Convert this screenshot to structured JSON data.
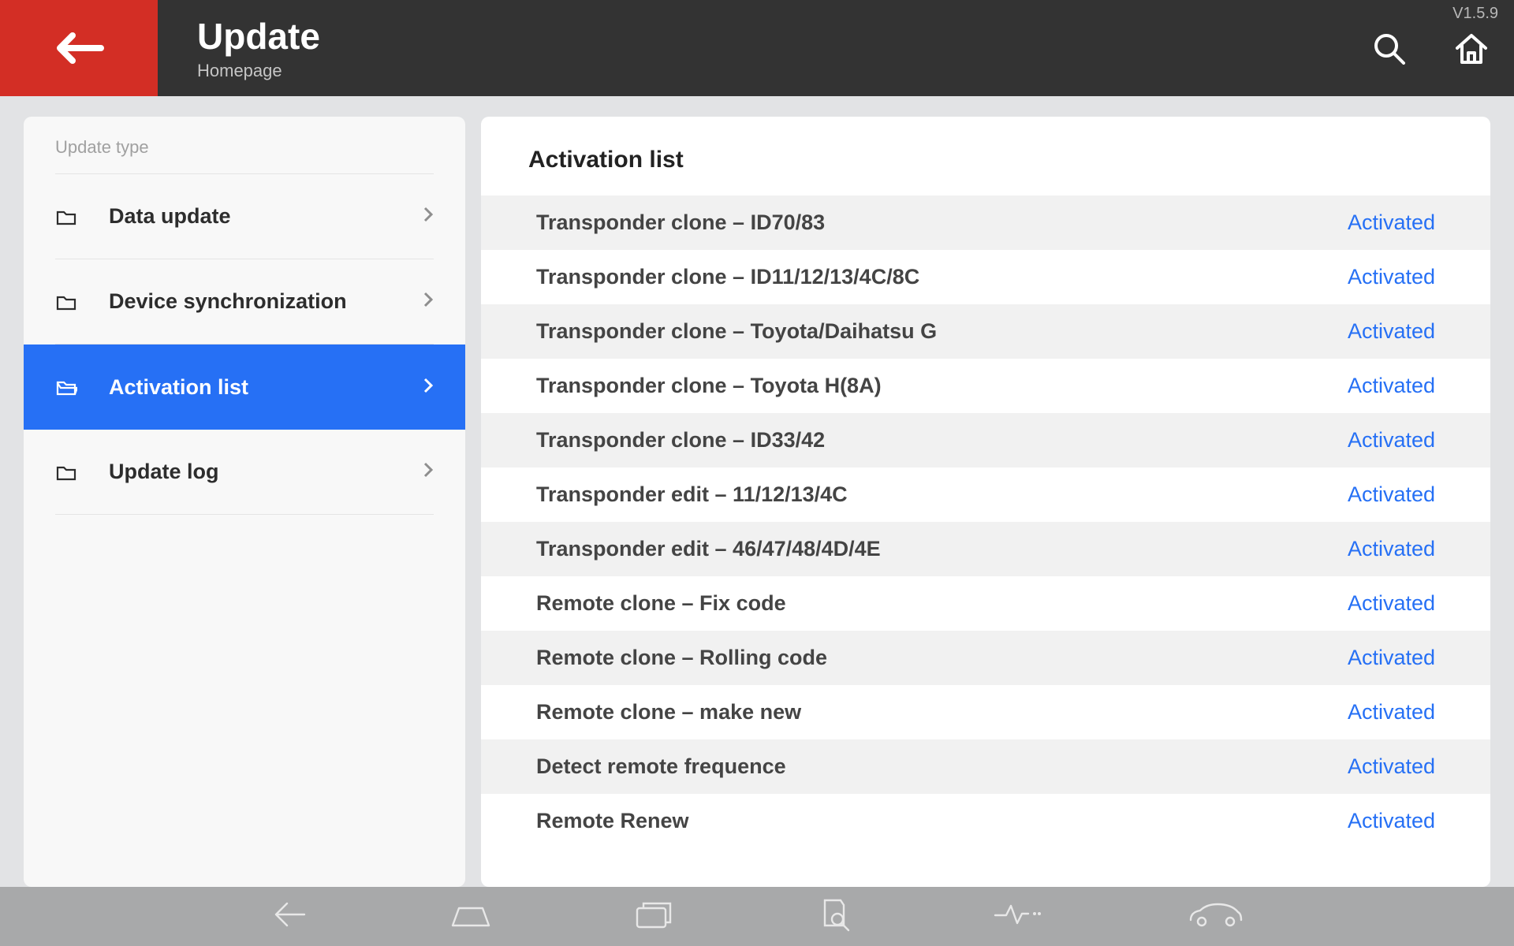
{
  "header": {
    "title": "Update",
    "subtitle": "Homepage",
    "version": "V1.5.9"
  },
  "sidebar": {
    "header": "Update type",
    "items": [
      {
        "label": "Data update",
        "active": false
      },
      {
        "label": "Device synchronization",
        "active": false
      },
      {
        "label": "Activation list",
        "active": true
      },
      {
        "label": "Update log",
        "active": false
      }
    ]
  },
  "main": {
    "title": "Activation list",
    "rows": [
      {
        "label": "Transponder clone – ID70/83",
        "status": "Activated"
      },
      {
        "label": "Transponder clone – ID11/12/13/4C/8C",
        "status": "Activated"
      },
      {
        "label": "Transponder clone – Toyota/Daihatsu G",
        "status": "Activated"
      },
      {
        "label": "Transponder clone – Toyota H(8A)",
        "status": "Activated"
      },
      {
        "label": "Transponder clone – ID33/42",
        "status": "Activated"
      },
      {
        "label": "Transponder edit – 11/12/13/4C",
        "status": "Activated"
      },
      {
        "label": "Transponder edit – 46/47/48/4D/4E",
        "status": "Activated"
      },
      {
        "label": "Remote clone – Fix code",
        "status": "Activated"
      },
      {
        "label": "Remote clone – Rolling code",
        "status": "Activated"
      },
      {
        "label": "Remote clone – make new",
        "status": "Activated"
      },
      {
        "label": "Detect remote frequence",
        "status": "Activated"
      },
      {
        "label": "Remote Renew",
        "status": "Activated"
      }
    ]
  }
}
